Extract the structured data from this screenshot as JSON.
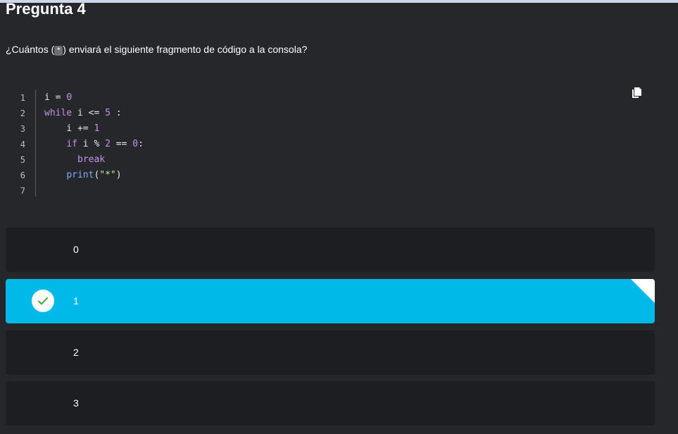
{
  "header": {
    "title": "Pregunta 4"
  },
  "question": {
    "text_before": "¿Cuántos (",
    "inline_code": "*",
    "text_after": ") enviará el siguiente fragmento de código a la consola?"
  },
  "code": {
    "line_numbers": [
      "1",
      "2",
      "3",
      "4",
      "5",
      "6",
      "7"
    ],
    "lines": [
      [
        {
          "t": "i = ",
          "c": "var"
        },
        {
          "t": "0",
          "c": "num"
        }
      ],
      [
        {
          "t": "while",
          "c": "kw"
        },
        {
          "t": " i <= ",
          "c": "var"
        },
        {
          "t": "5",
          "c": "num"
        },
        {
          "t": " :",
          "c": "op"
        }
      ],
      [
        {
          "t": "    i += ",
          "c": "var"
        },
        {
          "t": "1",
          "c": "num"
        }
      ],
      [
        {
          "t": "    ",
          "c": "var"
        },
        {
          "t": "if",
          "c": "kw"
        },
        {
          "t": " i % ",
          "c": "var"
        },
        {
          "t": "2",
          "c": "num"
        },
        {
          "t": " == ",
          "c": "op"
        },
        {
          "t": "0",
          "c": "num"
        },
        {
          "t": ":",
          "c": "op"
        }
      ],
      [
        {
          "t": "      ",
          "c": "var"
        },
        {
          "t": "break",
          "c": "break"
        }
      ],
      [
        {
          "t": "    ",
          "c": "var"
        },
        {
          "t": "print",
          "c": "fn"
        },
        {
          "t": "(",
          "c": "op"
        },
        {
          "t": "\"*\"",
          "c": "str"
        },
        {
          "t": ")",
          "c": "op"
        }
      ],
      []
    ],
    "copy_icon": "copy-icon"
  },
  "options": [
    {
      "label": "0",
      "selected": false
    },
    {
      "label": "1",
      "selected": true
    },
    {
      "label": "2",
      "selected": false
    },
    {
      "label": "3",
      "selected": false
    }
  ],
  "colors": {
    "background": "#26272b",
    "option_bg": "#1d1e21",
    "selected_bg": "#00b9e8",
    "check_color": "#3aa635"
  }
}
